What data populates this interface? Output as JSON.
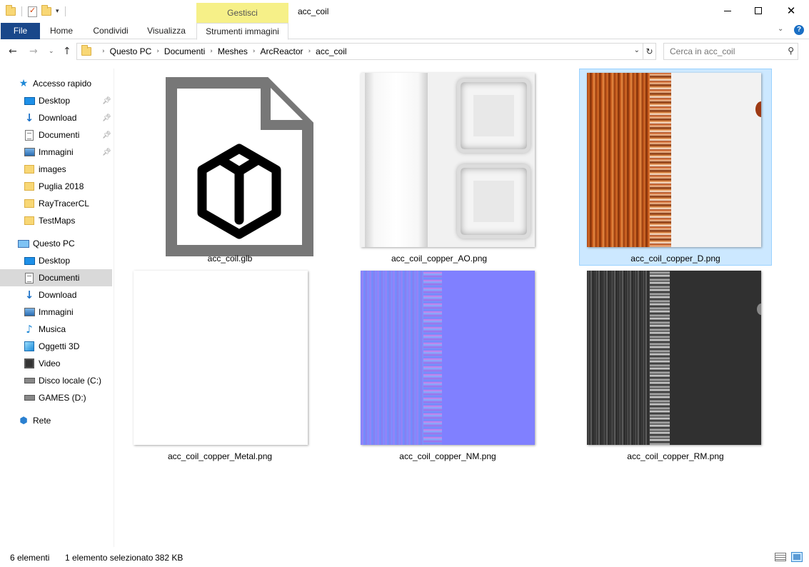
{
  "window": {
    "title": "acc_coil",
    "context_tab_group": "Gestisci"
  },
  "ribbon": {
    "tabs": [
      {
        "label": "File"
      },
      {
        "label": "Home"
      },
      {
        "label": "Condividi"
      },
      {
        "label": "Visualizza"
      },
      {
        "label": "Strumenti immagini"
      }
    ]
  },
  "address": {
    "breadcrumbs": [
      "Questo PC",
      "Documenti",
      "Meshes",
      "ArcReactor",
      "acc_coil"
    ]
  },
  "search": {
    "placeholder": "Cerca in acc_coil"
  },
  "sidebar": {
    "quick_access": {
      "label": "Accesso rapido",
      "items": [
        {
          "label": "Desktop",
          "icon": "desktop-icon",
          "pinned": true
        },
        {
          "label": "Download",
          "icon": "download-icon",
          "pinned": true
        },
        {
          "label": "Documenti",
          "icon": "document-icon",
          "pinned": true
        },
        {
          "label": "Immagini",
          "icon": "pictures-icon",
          "pinned": true
        },
        {
          "label": "images",
          "icon": "folder-icon",
          "pinned": false
        },
        {
          "label": "Puglia 2018",
          "icon": "folder-icon",
          "pinned": false
        },
        {
          "label": "RayTracerCL",
          "icon": "folder-icon",
          "pinned": false
        },
        {
          "label": "TestMaps",
          "icon": "folder-icon",
          "pinned": false
        }
      ]
    },
    "this_pc": {
      "label": "Questo PC",
      "items": [
        {
          "label": "Desktop",
          "icon": "desktop-icon"
        },
        {
          "label": "Documenti",
          "icon": "document-icon",
          "selected": true
        },
        {
          "label": "Download",
          "icon": "download-icon"
        },
        {
          "label": "Immagini",
          "icon": "pictures-icon"
        },
        {
          "label": "Musica",
          "icon": "music-icon"
        },
        {
          "label": "Oggetti 3D",
          "icon": "objects-3d-icon"
        },
        {
          "label": "Video",
          "icon": "video-icon"
        },
        {
          "label": "Disco locale (C:)",
          "icon": "system-drive-icon"
        },
        {
          "label": "GAMES (D:)",
          "icon": "drive-icon"
        }
      ]
    },
    "network": {
      "label": "Rete"
    }
  },
  "files": [
    {
      "name": "acc_coil.glb",
      "selected": false
    },
    {
      "name": "acc_coil_copper_AO.png",
      "selected": false
    },
    {
      "name": "acc_coil_copper_D.png",
      "selected": true
    },
    {
      "name": "acc_coil_copper_Metal.png",
      "selected": false
    },
    {
      "name": "acc_coil_copper_NM.png",
      "selected": false
    },
    {
      "name": "acc_coil_copper_RM.png",
      "selected": false
    }
  ],
  "status": {
    "count": "6 elementi",
    "selection": "1 elemento selezionato",
    "size": "382 KB"
  },
  "colors": {
    "file_tab": "#19478a",
    "context_tab": "#f6f088",
    "selection": "#cce8ff"
  }
}
